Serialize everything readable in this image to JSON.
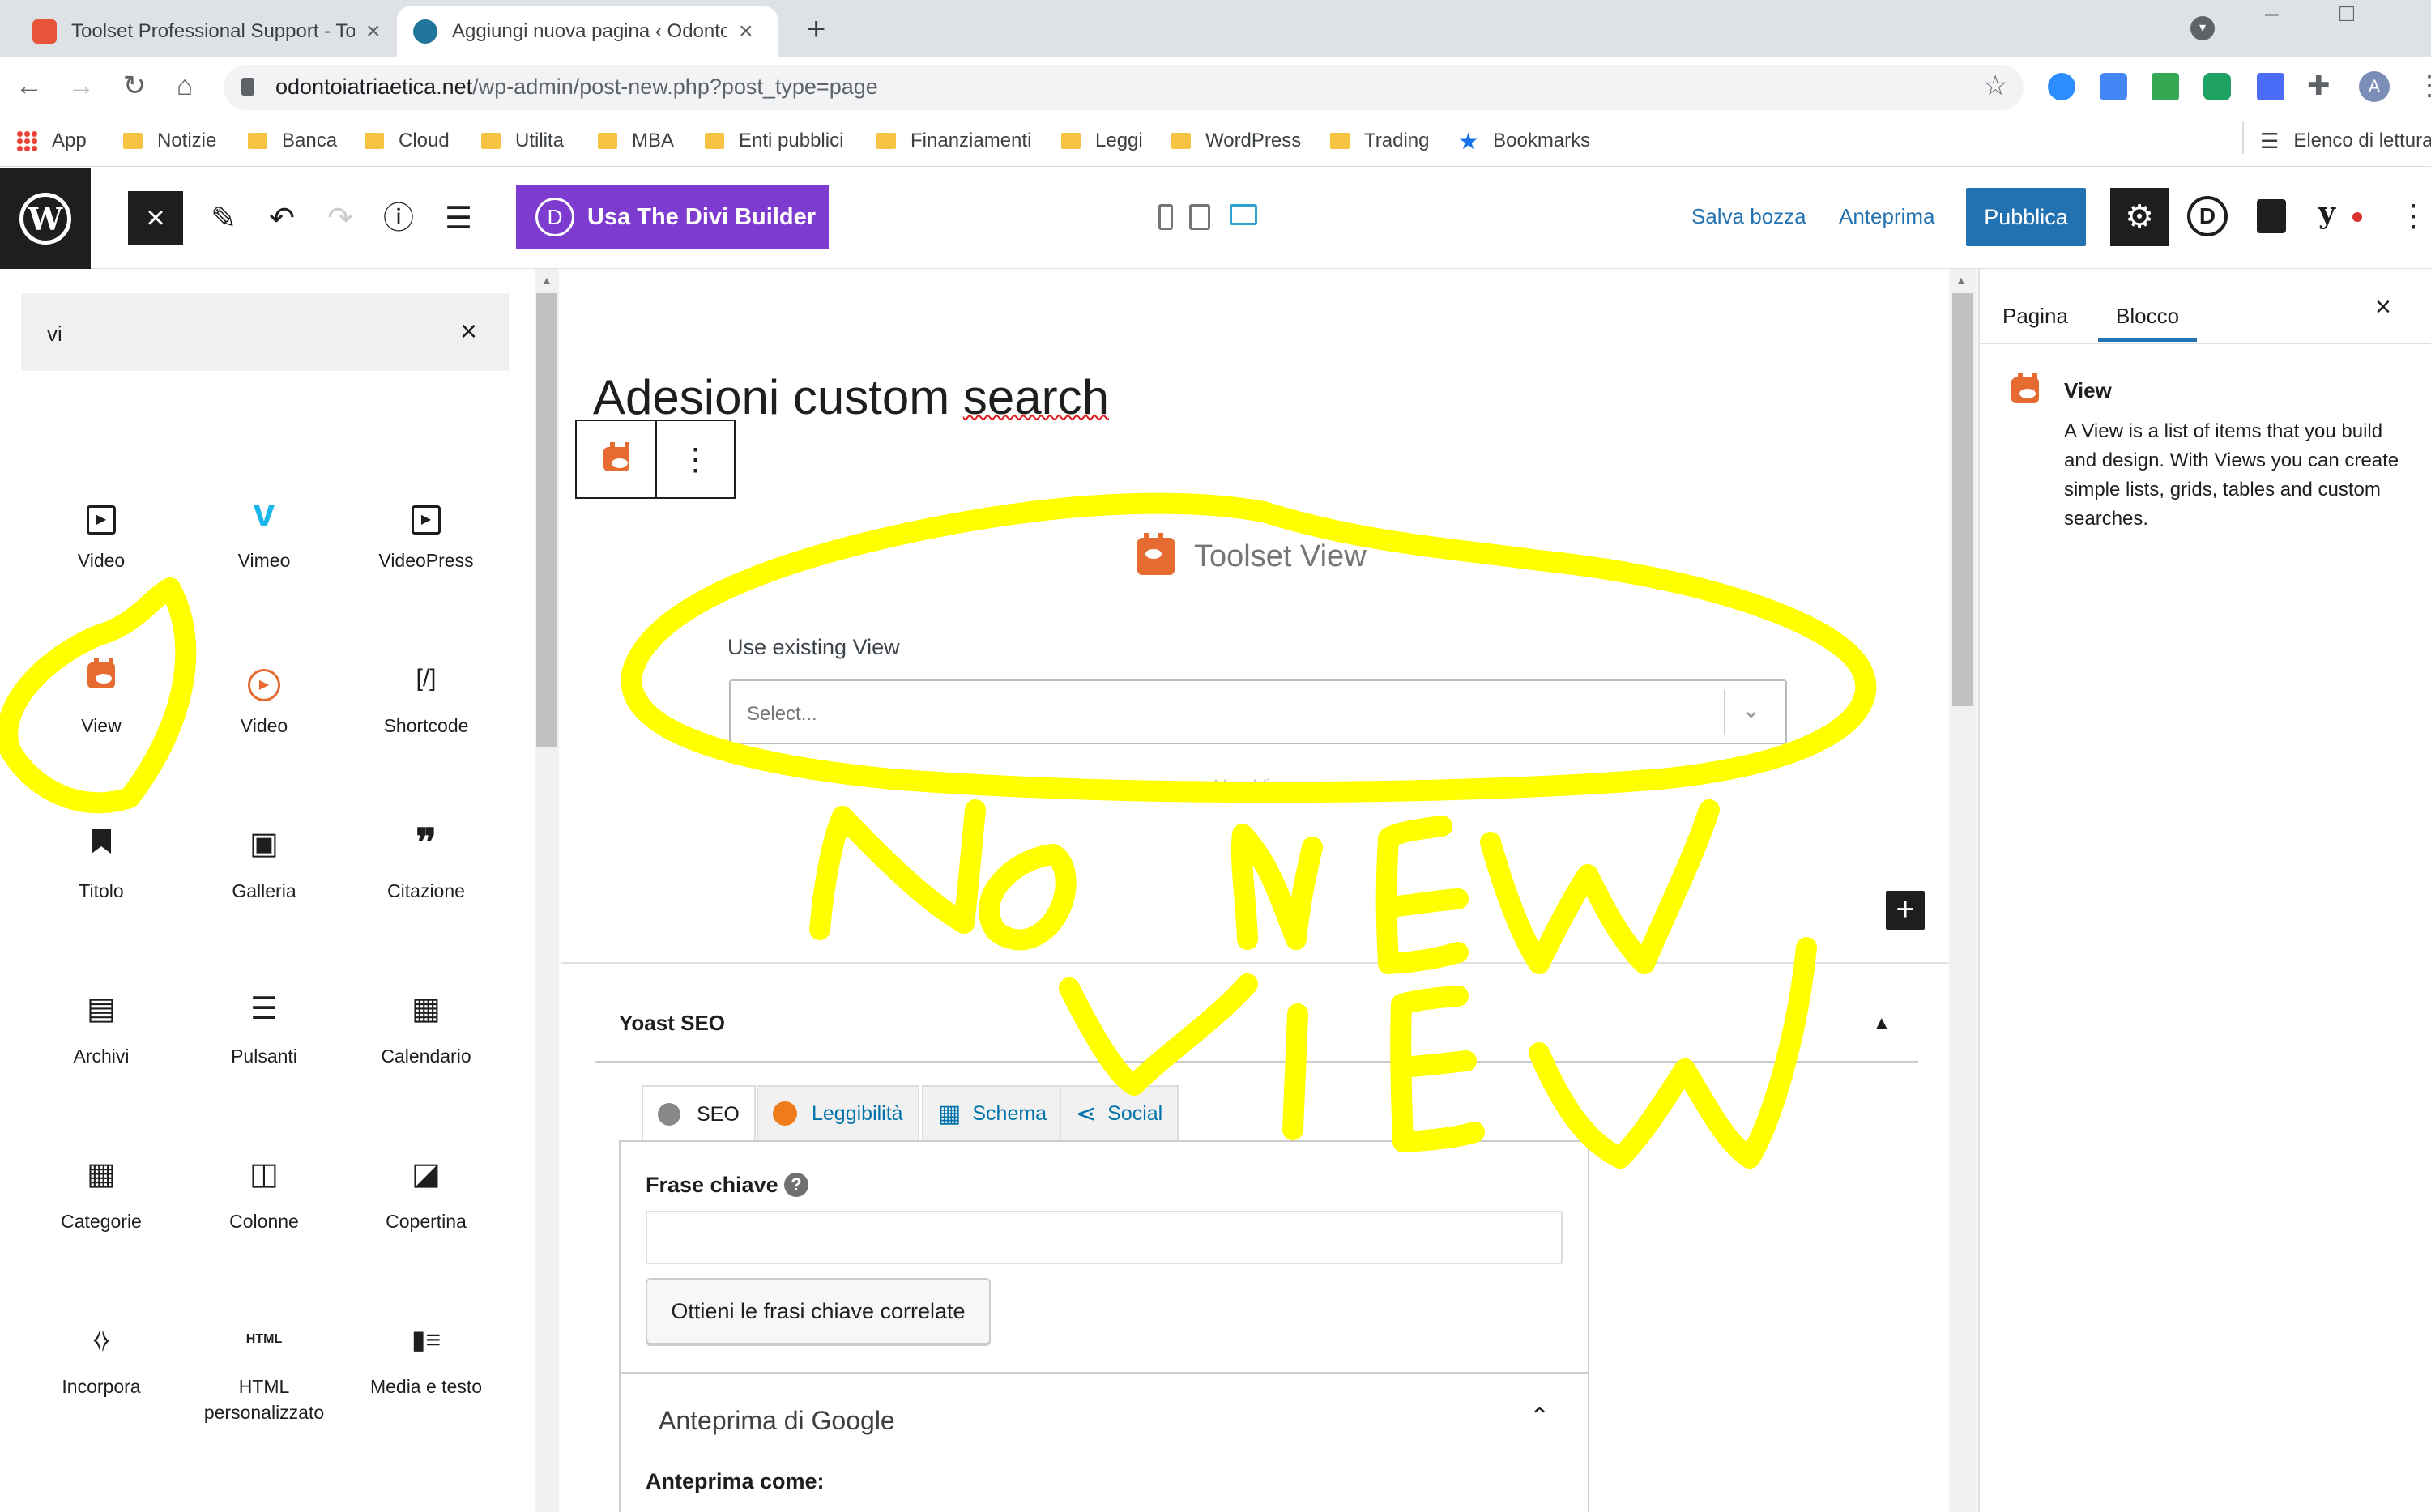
{
  "browser": {
    "tabs": [
      {
        "title": "Toolset Professional Support - To",
        "favicon_color": "#e8543a",
        "active": false
      },
      {
        "title": "Aggiungi nuova pagina ‹ Odonto",
        "favicon_color": "#21759b",
        "active": true
      }
    ],
    "new_tab_symbol": "+",
    "url_host": "odontoiatriaetica.net",
    "url_path": "/wp-admin/post-new.php?post_type=page",
    "profile_initial": "A",
    "bookmarks": [
      "App",
      "Notizie",
      "Banca",
      "Cloud",
      "Utilita",
      "MBA",
      "Enti pubblici",
      "Finanziamenti",
      "Leggi",
      "WordPress",
      "Trading",
      "Bookmarks"
    ],
    "reading_list": "Elenco di lettura"
  },
  "editor_bar": {
    "divi_button": "Usa The Divi Builder",
    "divi_letter": "D",
    "save_draft": "Salva bozza",
    "preview": "Anteprima",
    "publish": "Pubblica"
  },
  "inserter": {
    "search_value": "vi",
    "blocks": [
      {
        "label": "Video",
        "icon": "video-icon",
        "glyph": "▶"
      },
      {
        "label": "Vimeo",
        "icon": "vimeo-icon",
        "glyph": "v"
      },
      {
        "label": "VideoPress",
        "icon": "videopress-icon",
        "glyph": "▶"
      },
      {
        "label": "View",
        "icon": "toolset-view-icon",
        "glyph": ""
      },
      {
        "label": "Video",
        "icon": "play-circle-icon",
        "glyph": "▶"
      },
      {
        "label": "Shortcode",
        "icon": "shortcode-icon",
        "glyph": "[/]"
      },
      {
        "label": "Titolo",
        "icon": "bookmark-icon",
        "glyph": "⚑"
      },
      {
        "label": "Galleria",
        "icon": "gallery-icon",
        "glyph": "▣"
      },
      {
        "label": "Citazione",
        "icon": "quote-icon",
        "glyph": "❞"
      },
      {
        "label": "Archivi",
        "icon": "archive-icon",
        "glyph": "▤"
      },
      {
        "label": "Pulsanti",
        "icon": "buttons-icon",
        "glyph": "☰"
      },
      {
        "label": "Calendario",
        "icon": "calendar-icon",
        "glyph": "▦"
      },
      {
        "label": "Categorie",
        "icon": "categories-icon",
        "glyph": "▦"
      },
      {
        "label": "Colonne",
        "icon": "columns-icon",
        "glyph": "◫"
      },
      {
        "label": "Copertina",
        "icon": "cover-icon",
        "glyph": "◪"
      },
      {
        "label": "Incorpora",
        "icon": "embed-icon",
        "glyph": "⧼⧽"
      },
      {
        "label": "HTML personalizzato",
        "icon": "html-icon",
        "glyph": "HTML"
      },
      {
        "label": "Media e testo",
        "icon": "media-text-icon",
        "glyph": "▮≡"
      }
    ]
  },
  "canvas": {
    "title_start": "Adesioni custom ",
    "title_misspelled": "search",
    "toolset": {
      "heading": "Toolset View",
      "label": "Use existing View",
      "select_placeholder": "Select...",
      "use_button": "Use View"
    }
  },
  "yoast": {
    "title": "Yoast SEO",
    "tabs": [
      "SEO",
      "Leggibilità",
      "Schema",
      "Social"
    ],
    "focus_keyphrase_label": "Frase chiave",
    "focus_keyphrase_value": "",
    "related_button": "Ottieni le frasi chiave correlate",
    "google_preview_title": "Anteprima di Google",
    "preview_as_label": "Anteprima come:"
  },
  "settings_sidebar": {
    "tabs": [
      "Pagina",
      "Blocco"
    ],
    "active_tab": "Blocco",
    "block_name": "View",
    "block_description": "A View is a list of items that you build and design. With Views you can create simple lists, grids, tables and custom searches."
  },
  "annotation": {
    "handwritten_text": "NO NEW VIEW",
    "marker_color": "#ffff00"
  },
  "colors": {
    "wp_blue": "#2271b1",
    "divi_purple": "#7e3bd0",
    "toolset_orange": "#e56b30"
  }
}
